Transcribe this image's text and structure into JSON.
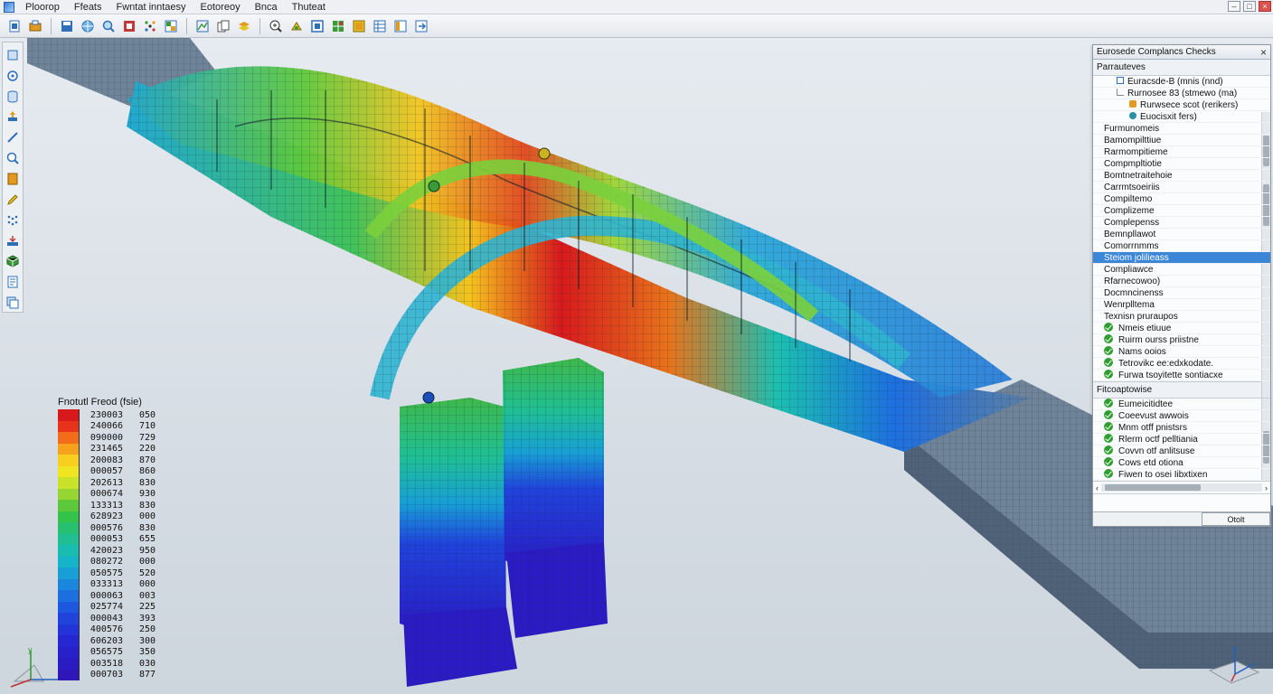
{
  "menu": {
    "items": [
      "Ploorop",
      "Ffeats",
      "Fwntat inntaesy",
      "Eotoreoy",
      "Bnca",
      "Thuteat"
    ]
  },
  "window_controls": {
    "minimize": "–",
    "maximize": "□",
    "close": "×"
  },
  "toolbar": {
    "icons": [
      "new-file-icon",
      "open-icon",
      "save-icon",
      "globe-icon",
      "search-icon",
      "snap-icon",
      "dots-icon",
      "grid-view-icon",
      "chart-icon",
      "copy-icon",
      "layers-icon",
      "zoom-icon",
      "node-icon",
      "frame-icon",
      "mesh-icon",
      "color-icon",
      "table-icon",
      "panel-icon",
      "export-icon"
    ]
  },
  "left_tools": {
    "icons": [
      "select-icon",
      "rotate-icon",
      "cylinder-icon",
      "move-icon",
      "line-icon",
      "magnify-icon",
      "document-icon",
      "pencil-icon",
      "points-icon",
      "load-icon",
      "cube-icon",
      "report-icon",
      "stack-icon"
    ]
  },
  "legend": {
    "title": "Fnotutl Freod (fsie)",
    "rows": [
      {
        "a": "230003",
        "b": "050",
        "color": "#d7191c"
      },
      {
        "a": "240066",
        "b": "710",
        "color": "#e8331a"
      },
      {
        "a": "090000",
        "b": "729",
        "color": "#f26c1a"
      },
      {
        "a": "231465",
        "b": "220",
        "color": "#f7a21d"
      },
      {
        "a": "200083",
        "b": "870",
        "color": "#f9cf1f"
      },
      {
        "a": "000057",
        "b": "860",
        "color": "#f1e521"
      },
      {
        "a": "202613",
        "b": "830",
        "color": "#c8e22a"
      },
      {
        "a": "000674",
        "b": "930",
        "color": "#97d632"
      },
      {
        "a": "133313",
        "b": "830",
        "color": "#5dc93a"
      },
      {
        "a": "628923",
        "b": "000",
        "color": "#33c24a"
      },
      {
        "a": "000576",
        "b": "830",
        "color": "#27c070"
      },
      {
        "a": "000053",
        "b": "655",
        "color": "#1fbf93"
      },
      {
        "a": "420023",
        "b": "950",
        "color": "#18bcb1"
      },
      {
        "a": "080272",
        "b": "000",
        "color": "#16b4c8"
      },
      {
        "a": "050575",
        "b": "520",
        "color": "#189fd6"
      },
      {
        "a": "033313",
        "b": "000",
        "color": "#1b87dc"
      },
      {
        "a": "000063",
        "b": "003",
        "color": "#1d6fe0"
      },
      {
        "a": "025774",
        "b": "225",
        "color": "#1f58e0"
      },
      {
        "a": "000043",
        "b": "393",
        "color": "#2043dc"
      },
      {
        "a": "400576",
        "b": "250",
        "color": "#2233d8"
      },
      {
        "a": "606203",
        "b": "300",
        "color": "#2528d2"
      },
      {
        "a": "056575",
        "b": "350",
        "color": "#2720cb"
      },
      {
        "a": "003518",
        "b": "030",
        "color": "#2b1bc2"
      },
      {
        "a": "000703",
        "b": "877",
        "color": "#2e16b8"
      }
    ]
  },
  "panel": {
    "title": "Eurosede Complancs Checks",
    "section1": "Parrauteves",
    "tree": [
      {
        "label": "Euracsde-B (mnis (nnd)",
        "indent": 1,
        "icon": "square"
      },
      {
        "label": "Rurnosee 83 (stmewo (ma)",
        "indent": 1,
        "icon": "none"
      },
      {
        "label": "Rurwsece scot (rerikers)",
        "indent": 2,
        "icon": "orange"
      },
      {
        "label": "Euocisxit fers)",
        "indent": 2,
        "icon": "teal"
      }
    ],
    "items": [
      "Furmunomeis",
      "Bamompilttiue",
      "Rarmompitieme",
      "Compmpltiotie",
      "Bomtnetraitehoie",
      "Carrmtsoeiriis",
      "Compiltemo",
      "Complizeme",
      "Complepenss",
      "Bemnpllawot",
      "Comorrnmms",
      "Steiom jolilieass",
      "Compliawce",
      "Rfarnecowoo)",
      "Docmncinenss",
      "Wenrplltema",
      "Texnisn pruraupos"
    ],
    "selected_index": 11,
    "checks1": [
      "Nmeis etiuue",
      "Ruirm ourss priistne",
      "Nams ooios",
      "Tetrovikc ee:edxkodate.",
      "Furwa tsoyitette sontiacxe"
    ],
    "section2": "Fitcoaptowise",
    "checks2": [
      "Eumeicitidtee",
      "Coeevust awwois",
      "Mnm otff pnistsrs",
      "Rlerm octf pelltiania",
      "Covvn otf anlitsuse",
      "Cows etd otiona",
      "Fiwen to osei Iibxtixen"
    ],
    "scroll_left": "‹",
    "scroll_right": "›",
    "footer_button": "Otolt"
  },
  "colors": {
    "accent": "#3b86d6",
    "check": "#2f9e2f",
    "hot": "#d7191c",
    "cold": "#2e16b8"
  }
}
